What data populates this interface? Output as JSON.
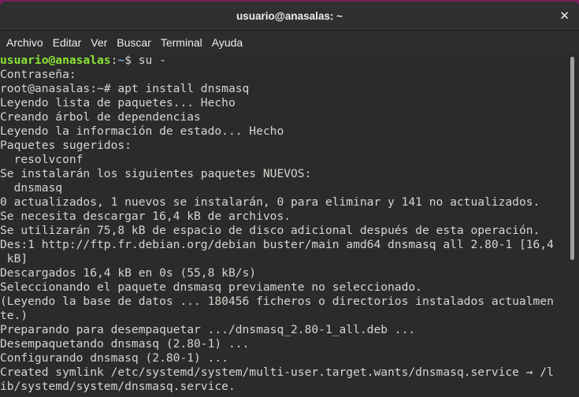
{
  "window": {
    "title": "usuario@anasalas: ~",
    "close_icon": "close-icon"
  },
  "menu": [
    "Archivo",
    "Editar",
    "Ver",
    "Buscar",
    "Terminal",
    "Ayuda"
  ],
  "terminal": {
    "prompt_user": "usuario@anasalas",
    "prompt_colon": ":",
    "prompt_path": "~",
    "prompt_rest": "$ su -",
    "lines": [
      "Contraseña:",
      "root@anasalas:~# apt install dnsmasq",
      "Leyendo lista de paquetes... Hecho",
      "Creando árbol de dependencias",
      "Leyendo la información de estado... Hecho",
      "Paquetes sugeridos:",
      "  resolvconf",
      "Se instalarán los siguientes paquetes NUEVOS:",
      "  dnsmasq",
      "0 actualizados, 1 nuevos se instalarán, 0 para eliminar y 141 no actualizados.",
      "Se necesita descargar 16,4 kB de archivos.",
      "Se utilizarán 75,8 kB de espacio de disco adicional después de esta operación.",
      "Des:1 http://ftp.fr.debian.org/debian buster/main amd64 dnsmasq all 2.80-1 [16,4",
      " kB]",
      "Descargados 16,4 kB en 0s (55,8 kB/s)",
      "Seleccionando el paquete dnsmasq previamente no seleccionado.",
      "(Leyendo la base de datos ... 180456 ficheros o directorios instalados actualmen",
      "te.)",
      "Preparando para desempaquetar .../dnsmasq_2.80-1_all.deb ...",
      "Desempaquetando dnsmasq (2.80-1) ...",
      "Configurando dnsmasq (2.80-1) ...",
      "Created symlink /etc/systemd/system/multi-user.target.wants/dnsmasq.service → /l",
      "ib/systemd/system/dnsmasq.service."
    ]
  },
  "colors": {
    "prompt_user": "#8ae234",
    "prompt_path": "#729fcf",
    "background": "#2b2b2b"
  }
}
